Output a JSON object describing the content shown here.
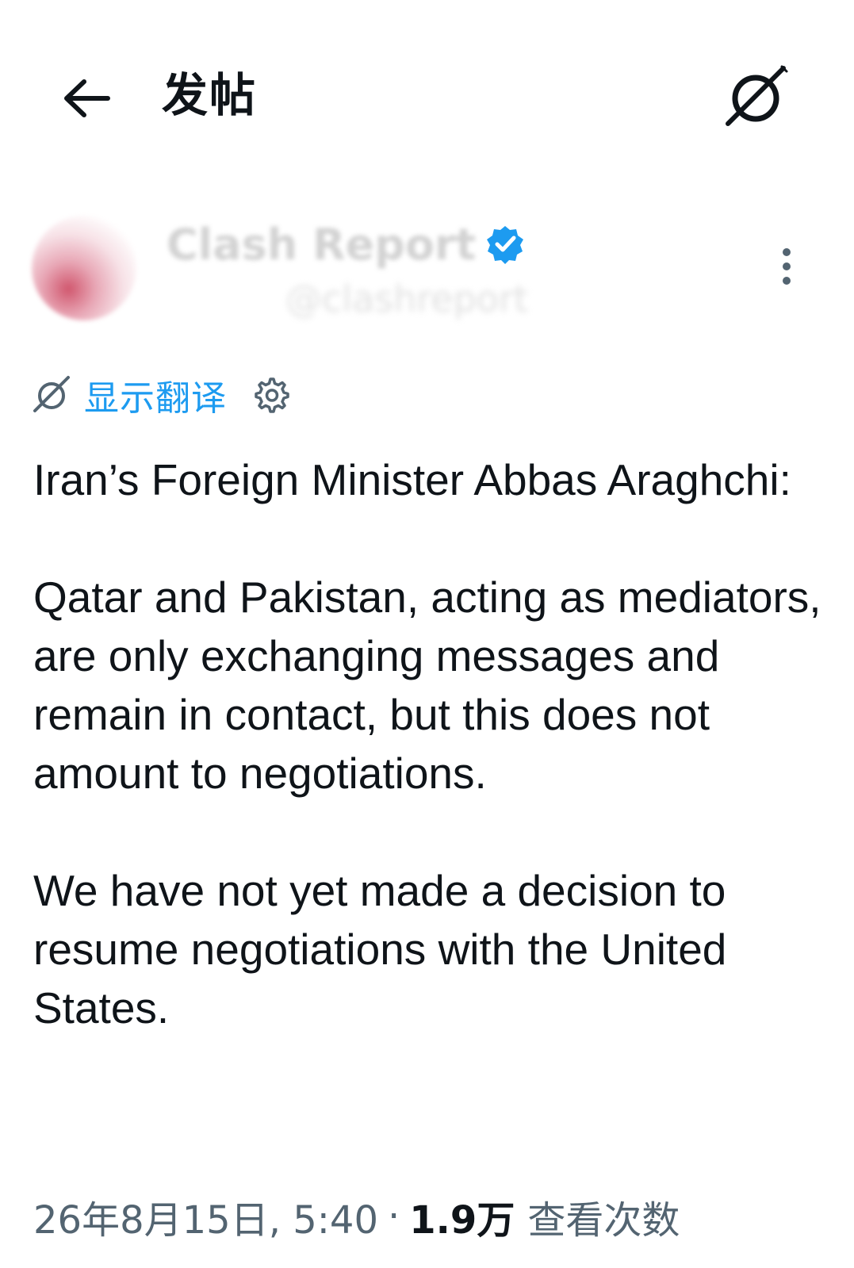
{
  "header": {
    "back_icon": "arrow-left-icon",
    "title": "发帖",
    "grok_icon": "grok-icon"
  },
  "author": {
    "name": "Clash Report",
    "handle": "@clashreport",
    "verified": true,
    "verified_color": "#1d9bf0",
    "more_icon": "more-vertical-icon"
  },
  "translate": {
    "icon": "grok-icon",
    "label": "显示翻译",
    "settings_icon": "gear-icon",
    "link_color": "#1d9bf0"
  },
  "post": {
    "paragraphs": [
      "Iran’s Foreign Minister Abbas Araghchi:",
      "Qatar and Pakistan, acting as mediators, are only exchanging messages and remain in contact, but this does not amount to negotiations.",
      "We have not yet made a decision to resume negotiations with the United States."
    ]
  },
  "meta": {
    "timestamp": "26年8月15日, 5:40",
    "separator": "·",
    "views": "1.9万",
    "views_label": "查看次数"
  }
}
